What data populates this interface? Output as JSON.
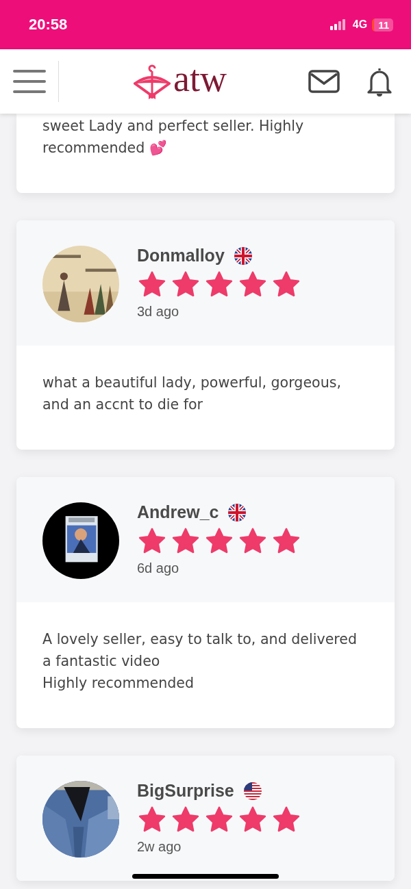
{
  "status_bar": {
    "time": "20:58",
    "network": "4G",
    "battery": "11"
  },
  "header": {
    "logo": "atw"
  },
  "reviews": [
    {
      "partial": true,
      "text": "sweet Lady and perfect seller. Highly recommended 💕"
    },
    {
      "partial": false,
      "name": "Donmalloy",
      "flag": {
        "kind": "gb"
      },
      "stars": 5,
      "time": "3d ago",
      "text": "what a beautiful lady, powerful, gorgeous, and an accnt to die for"
    },
    {
      "partial": false,
      "name": "Andrew_c",
      "flag": {
        "kind": "gb"
      },
      "stars": 5,
      "time": "6d ago",
      "text": "A lovely seller, easy to talk to, and delivered a fantastic video\nHighly recommended"
    },
    {
      "partial": false,
      "name": "BigSurprise",
      "flag": {
        "kind": "us"
      },
      "stars": 5,
      "time": "2w ago"
    }
  ]
}
